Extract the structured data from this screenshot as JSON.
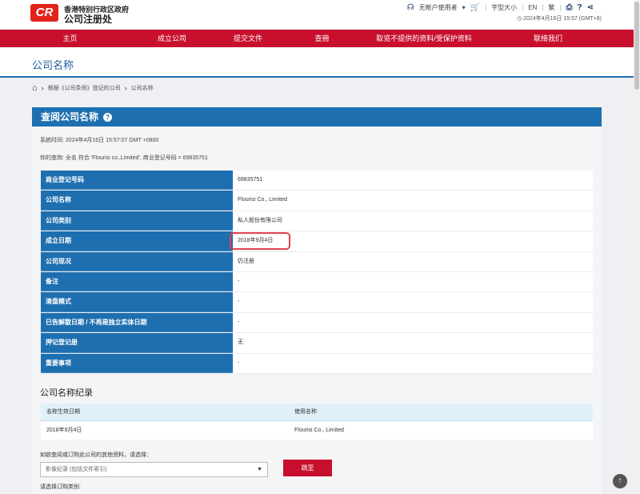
{
  "header": {
    "logo_text": "CR",
    "org_line1": "香港特别行政区政府",
    "org_line2": "公司注册处",
    "user_label": "无帐户使用者",
    "font_size_label": "字型大小",
    "lang_en": "EN",
    "lang_tc": "繁",
    "datetime": "2024年4月16日 15:57 (GMT+8)"
  },
  "nav": [
    "主页",
    "成立公司",
    "提交文件",
    "查冊",
    "取览不提供的资料/受保护资料",
    "联络我们"
  ],
  "page_title": "公司名称",
  "breadcrumb": [
    "根据《公司条例》登記的公司",
    "公司名称"
  ],
  "panel": {
    "title": "查阅公司名称",
    "system_time_label": "系統时间:",
    "system_time": "2024年4月16日 15:57:07 GMT +0800",
    "query_label": "你的查詢:",
    "query_text": "全名 符合 'Flourisi co.,Limited', 商业登记号码 = 69835751"
  },
  "details": [
    {
      "label": "商业登记号码",
      "value": "69835751"
    },
    {
      "label": "公司名称",
      "value": "Flourisi Co., Limited"
    },
    {
      "label": "公司类别",
      "value": "私人股份有限公司"
    },
    {
      "label": "成立日期",
      "value": "2018年9月4日"
    },
    {
      "label": "公司现况",
      "value": "仍注册"
    },
    {
      "label": "备注",
      "value": "-"
    },
    {
      "label": "清盘模式",
      "value": "-"
    },
    {
      "label": "已告解散日期 / 不再是独立实体日期",
      "value": "-"
    },
    {
      "label": "押记登记册",
      "value": "无"
    },
    {
      "label": "重要事项",
      "value": "-"
    }
  ],
  "history": {
    "title": "公司名称纪录",
    "col_date": "名称生效日期",
    "col_name": "使用名称",
    "rows": [
      {
        "date": "2018年9月4日",
        "name": "Flourisi Co., Limited"
      }
    ]
  },
  "order": {
    "question": "如欲查阅或订购此公司的其他资料，请选择：",
    "select_value": "影像纪录 (包括文件索引)",
    "go_label": "跳至",
    "type_label": "请选择订购类别:"
  }
}
